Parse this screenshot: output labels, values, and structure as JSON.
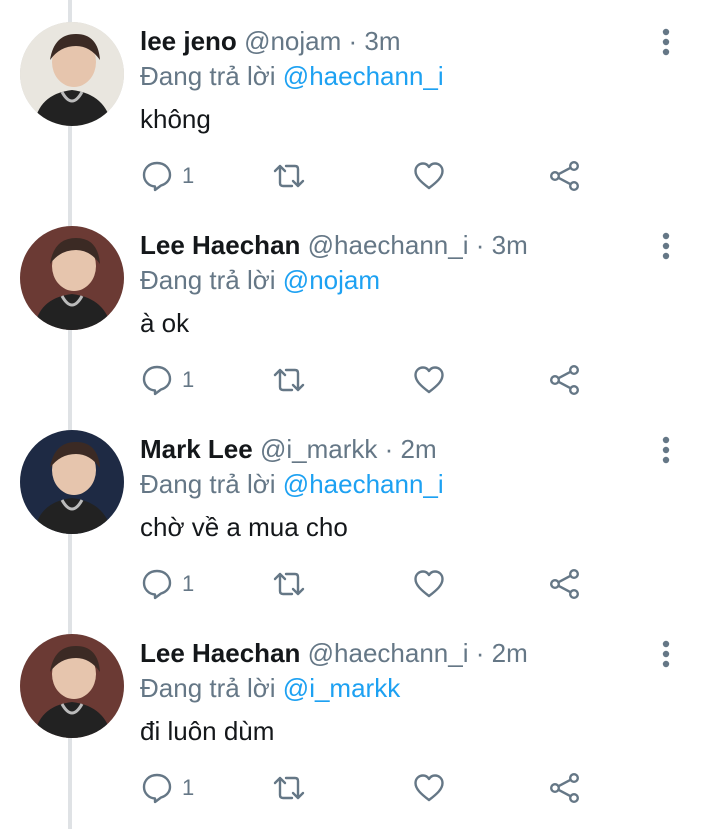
{
  "tweets": [
    {
      "display_name": "lee jeno",
      "handle": "@nojam",
      "time": "3m",
      "reply_prefix": "Đang trả lời",
      "reply_to": "@haechann_i",
      "text": "không",
      "reply_count": "1",
      "avatar_bg": "#e9e6df"
    },
    {
      "display_name": "Lee Haechan",
      "handle": "@haechann_i",
      "time": "3m",
      "reply_prefix": "Đang trả lời",
      "reply_to": "@nojam",
      "text": "à ok",
      "reply_count": "1",
      "avatar_bg": "#6b3a34"
    },
    {
      "display_name": "Mark Lee",
      "handle": "@i_markk",
      "time": "2m",
      "reply_prefix": "Đang trả lời",
      "reply_to": "@haechann_i",
      "text": "chờ về a mua cho",
      "reply_count": "1",
      "avatar_bg": "#1e2a44"
    },
    {
      "display_name": "Lee Haechan",
      "handle": "@haechann_i",
      "time": "2m",
      "reply_prefix": "Đang trả lời",
      "reply_to": "@i_markk",
      "text": "đi luôn dùm",
      "reply_count": "1",
      "avatar_bg": "#6b3a34"
    }
  ],
  "colors": {
    "accent": "#1da1f2",
    "muted": "#657786",
    "text": "#14171a",
    "thread_line": "#dfe2e5"
  },
  "icons": [
    "more-vertical-icon",
    "reply-icon",
    "retweet-icon",
    "like-icon",
    "share-icon"
  ]
}
